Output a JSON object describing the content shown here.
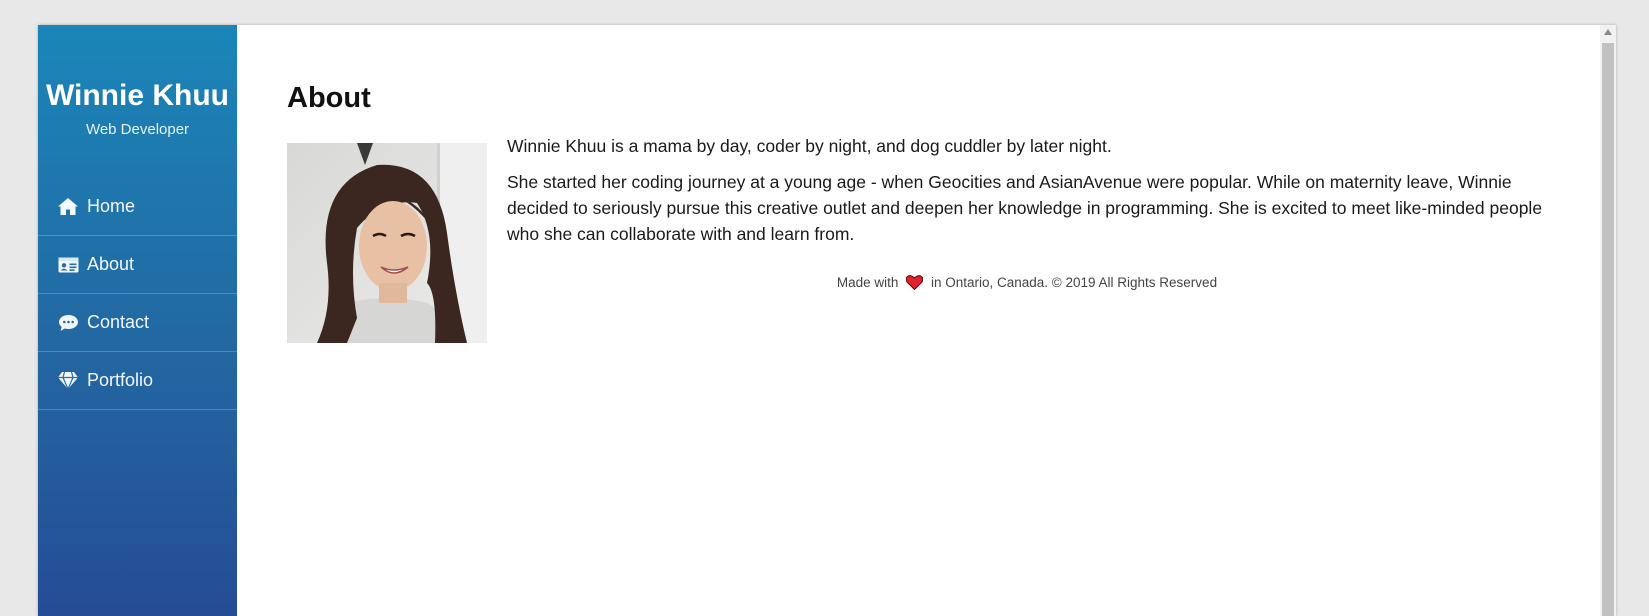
{
  "brand": {
    "name": "Winnie Khuu",
    "role": "Web Developer"
  },
  "nav": {
    "items": [
      {
        "label": "Home",
        "icon": "home-icon"
      },
      {
        "label": "About",
        "icon": "id-card-icon"
      },
      {
        "label": "Contact",
        "icon": "comment-icon"
      },
      {
        "label": "Portfolio",
        "icon": "gem-icon"
      }
    ]
  },
  "main": {
    "title": "About",
    "paragraphs": [
      "Winnie Khuu is a mama by day, coder by night, and dog cuddler by later night.",
      "She started her coding journey at a young age - when Geocities and AsianAvenue were popular. While on maternity leave, Winnie decided to seriously pursue this creative outlet and deepen her knowledge in programming. She is excited to meet like-minded people who she can collaborate with and learn from."
    ]
  },
  "footer": {
    "made_with": "Made with",
    "rest": "in Ontario, Canada. © 2019 All Rights Reserved",
    "heart_icon": "heart-icon",
    "heart_color": "#e0202a"
  },
  "colors": {
    "sidebar_top": "#1a86b8",
    "sidebar_bottom": "#254c95"
  }
}
